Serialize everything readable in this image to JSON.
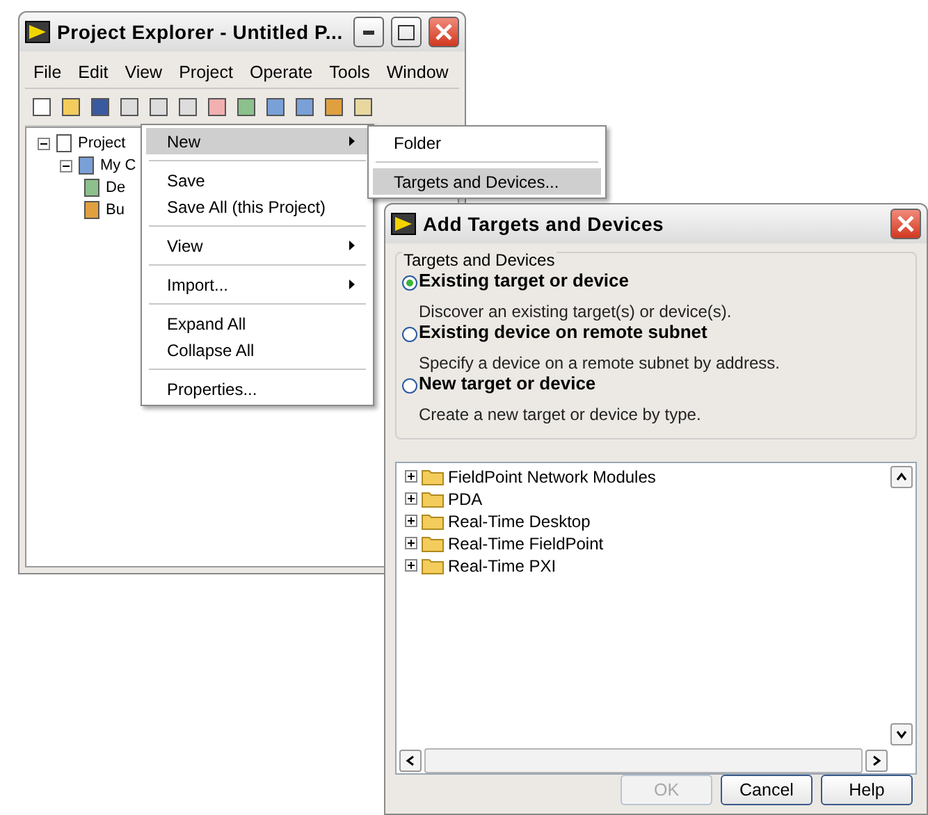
{
  "explorer": {
    "title": "Project Explorer - Untitled P...",
    "menu": [
      "File",
      "Edit",
      "View",
      "Project",
      "Operate",
      "Tools",
      "Window"
    ],
    "tree": [
      {
        "label": "Project",
        "expanded": true,
        "children": [
          {
            "label": "My C",
            "expanded": true,
            "children": [
              {
                "label": "De"
              },
              {
                "label": "Bu"
              }
            ]
          }
        ]
      }
    ]
  },
  "context_menu": {
    "groups": [
      [
        {
          "label": "New",
          "selected": true,
          "submenu": true
        }
      ],
      [
        {
          "label": "Save",
          "selected": false,
          "submenu": false
        },
        {
          "label": "Save All (this Project)",
          "selected": false,
          "submenu": false
        }
      ],
      [
        {
          "label": "View",
          "selected": false,
          "submenu": true
        }
      ],
      [
        {
          "label": "Import...",
          "selected": false,
          "submenu": true
        }
      ],
      [
        {
          "label": "Expand All",
          "selected": false,
          "submenu": false
        },
        {
          "label": "Collapse All",
          "selected": false,
          "submenu": false
        }
      ],
      [
        {
          "label": "Properties...",
          "selected": false,
          "submenu": false
        }
      ]
    ]
  },
  "submenu": {
    "groups": [
      [
        {
          "label": "Folder",
          "selected": false
        }
      ],
      [
        {
          "label": "Targets and Devices...",
          "selected": true
        }
      ]
    ]
  },
  "dialog": {
    "title": "Add Targets and Devices",
    "group_label": "Targets and Devices",
    "options": [
      {
        "label": "Existing target or device",
        "description": "Discover an existing target(s) or device(s).",
        "selected": true
      },
      {
        "label": "Existing device on remote subnet",
        "description": "Specify a device on a remote subnet by address.",
        "selected": false
      },
      {
        "label": "New target or device",
        "description": "Create a new target or device by type.",
        "selected": false
      }
    ],
    "tree": [
      {
        "label": "FieldPoint Network Modules",
        "expanded": false
      },
      {
        "label": "PDA",
        "expanded": false
      },
      {
        "label": "Real-Time Desktop",
        "expanded": false
      },
      {
        "label": "Real-Time FieldPoint",
        "expanded": false
      },
      {
        "label": "Real-Time PXI",
        "expanded": false
      }
    ],
    "buttons": [
      {
        "label": "OK",
        "disabled": true
      },
      {
        "label": "Cancel",
        "disabled": false
      },
      {
        "label": "Help",
        "disabled": false
      }
    ]
  }
}
